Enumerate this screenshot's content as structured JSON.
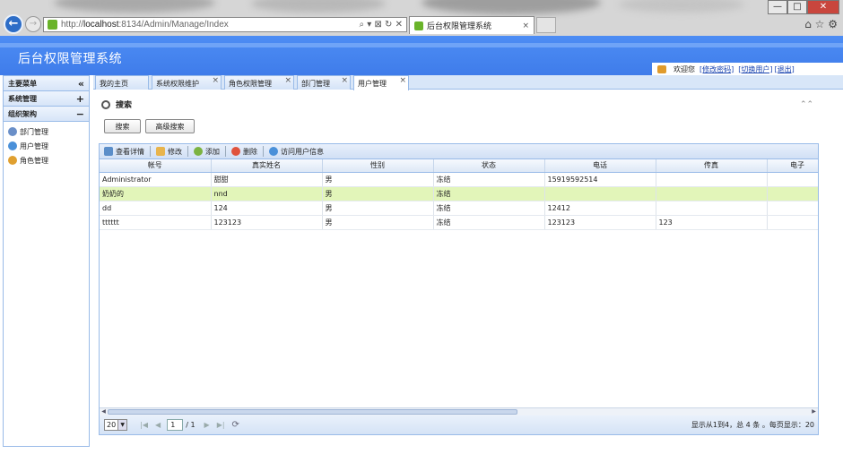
{
  "browser": {
    "back_icon": "back-arrow-icon",
    "forward_icon": "forward-arrow-icon",
    "url_prefix": "http://",
    "url_host": "localhost",
    "url_rest": ":8134/Admin/Manage/Index",
    "addr_controls": "⌕ ▾ ⊠ ↻ ✕",
    "tab_title": "后台权限管理系统",
    "tab_close": "×",
    "win_min": "—",
    "win_max": "□",
    "win_close": "✕",
    "tools": "⌂ ☆ ⚙"
  },
  "app": {
    "title": "后台权限管理系统",
    "welcome": "欢迎您",
    "change_pwd": "[修改密码]",
    "switch_user": "[切换用户]",
    "logout": "[退出]"
  },
  "sidebar": {
    "main_menu": "主要菜单",
    "main_toggle": "«",
    "sections": [
      {
        "label": "系统管理",
        "toggle": "+"
      },
      {
        "label": "组织架构",
        "toggle": "−"
      }
    ],
    "items": [
      {
        "label": "部门管理",
        "icon": "department-icon"
      },
      {
        "label": "用户管理",
        "icon": "user-icon"
      },
      {
        "label": "角色管理",
        "icon": "role-icon"
      }
    ]
  },
  "tabs": [
    {
      "label": "我的主页"
    },
    {
      "label": "系统权限维护",
      "close": "×"
    },
    {
      "label": "角色权限管理",
      "close": "×"
    },
    {
      "label": "部门管理",
      "close": "×"
    },
    {
      "label": "用户管理",
      "close": "×"
    }
  ],
  "search": {
    "title": "搜索",
    "collapse": "⌃⌃",
    "search_btn": "搜索",
    "advanced_btn": "高级搜索"
  },
  "toolbar": [
    {
      "label": "查看详情",
      "icon": "view-details-icon",
      "color": "#5b8ec9"
    },
    {
      "label": "修改",
      "icon": "edit-icon",
      "color": "#e8b44c"
    },
    {
      "label": "添加",
      "icon": "add-icon",
      "color": "#7cb342"
    },
    {
      "label": "删除",
      "icon": "delete-icon",
      "color": "#e0533d"
    },
    {
      "label": "访问用户信息",
      "icon": "user-info-icon",
      "color": "#4a90d9"
    }
  ],
  "grid": {
    "columns": [
      "帐号",
      "真实姓名",
      "性别",
      "状态",
      "电话",
      "传真",
      "电子"
    ],
    "rows": [
      [
        "Administrator",
        "甜甜",
        "男",
        "冻结",
        "15919592514",
        "",
        ""
      ],
      [
        "奶奶的",
        "nnd",
        "男",
        "冻结",
        "",
        "",
        ""
      ],
      [
        "dd",
        "124",
        "男",
        "冻结",
        "12412",
        "",
        ""
      ],
      [
        "tttttt",
        "123123",
        "男",
        "冻结",
        "123123",
        "123",
        ""
      ]
    ],
    "selected_row": 1
  },
  "pager": {
    "page_size": "20",
    "page": "1",
    "total_pages": "/ 1",
    "info": "显示从1到4，总 4 条 。每页显示：20"
  },
  "colors": {
    "header_blue": "#4d8df4",
    "selected_row": "#e2f5b9",
    "border_blue": "#99bbe8"
  }
}
